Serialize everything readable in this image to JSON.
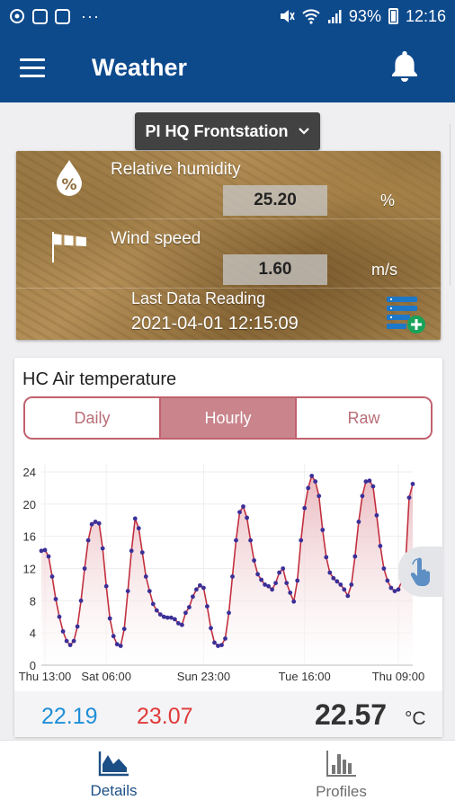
{
  "status_bar": {
    "battery": "93%",
    "time": "12:16",
    "more": "···"
  },
  "app_bar": {
    "title": "Weather"
  },
  "station": {
    "label": "PI HQ Frontstation"
  },
  "metrics": [
    {
      "label": "Relative humidity",
      "value": "25.20",
      "unit": "%",
      "icon": "humidity-percent-icon"
    },
    {
      "label": "Wind speed",
      "value": "1.60",
      "unit": "m/s",
      "icon": "windsock-icon"
    }
  ],
  "last_reading": {
    "label": "Last Data Reading",
    "value": "2021-04-01 12:15:09"
  },
  "chart_card": {
    "title": "HC Air temperature",
    "tabs": [
      "Daily",
      "Hourly",
      "Raw"
    ],
    "active_tab": "Hourly",
    "stats": {
      "min": "22.19",
      "max": "23.07",
      "current": "22.57",
      "unit": "°C"
    }
  },
  "chart_data": {
    "type": "area",
    "title": "",
    "xlabel": "",
    "ylabel": "",
    "ylim": [
      0,
      25
    ],
    "yticks": [
      0,
      4,
      8,
      12,
      16,
      20,
      24
    ],
    "x_ticks": [
      {
        "label": "Thu 13:00",
        "index": 1
      },
      {
        "label": "Sat 06:00",
        "index": 18
      },
      {
        "label": "Sun 23:00",
        "index": 45
      },
      {
        "label": "Tue 16:00",
        "index": 73
      },
      {
        "label": "Thu 09:00",
        "index": 99
      }
    ],
    "grid": true,
    "line_color": "#c2303f",
    "fill_color": "#e9b7bd",
    "point_color": "#3b2f98",
    "series": [
      {
        "values": [
          14.2,
          14.3,
          13.5,
          11.0,
          8.2,
          6.0,
          4.2,
          3.0,
          2.5,
          3.0,
          4.8,
          8.0,
          12.0,
          15.5,
          17.5,
          17.8,
          17.6,
          14.5,
          9.8,
          5.8,
          3.6,
          2.6,
          2.4,
          4.5,
          9.2,
          14.2,
          18.2,
          17.0,
          14.0,
          11.0,
          9.2,
          7.6,
          6.8,
          6.3,
          6.0,
          5.9,
          5.9,
          5.7,
          5.2,
          5.0,
          6.5,
          7.2,
          8.5,
          9.4,
          9.9,
          9.6,
          7.3,
          4.6,
          2.8,
          2.4,
          2.5,
          3.3,
          6.5,
          11.0,
          15.5,
          19.0,
          19.7,
          18.3,
          15.5,
          13.0,
          11.3,
          10.6,
          10.0,
          9.8,
          9.4,
          10.2,
          11.5,
          12.0,
          10.2,
          9.0,
          7.9,
          10.5,
          15.5,
          19.5,
          22.0,
          23.5,
          22.8,
          21.0,
          16.8,
          13.4,
          11.5,
          10.8,
          10.4,
          10.0,
          9.4,
          8.6,
          10.0,
          13.5,
          17.8,
          21.0,
          22.8,
          22.9,
          22.2,
          18.6,
          14.8,
          12.0,
          10.5,
          9.6,
          9.2,
          9.4,
          10.5,
          12.5,
          20.8,
          22.5
        ]
      }
    ]
  },
  "bottom_nav": {
    "items": [
      {
        "label": "Details",
        "icon": "area-chart-icon",
        "active": true
      },
      {
        "label": "Profiles",
        "icon": "bar-chart-icon",
        "active": false
      }
    ]
  }
}
